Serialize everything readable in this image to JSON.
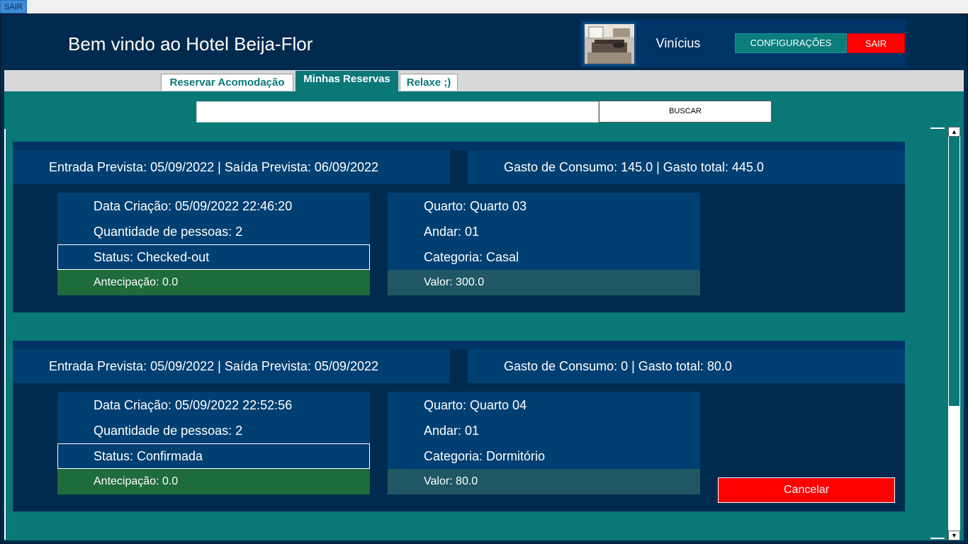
{
  "top_bar": {
    "exit_label": "SAIR"
  },
  "header": {
    "welcome": "Bem vindo ao Hotel Beija-Flor",
    "user_name": "Vinícius",
    "settings_label": "CONFIGURAÇÕES",
    "exit_label": "SAIR"
  },
  "tabs": [
    {
      "label": "Reservar Acomodação",
      "active": false
    },
    {
      "label": "Minhas Reservas",
      "active": true
    },
    {
      "label": "Relaxe ;)",
      "active": false
    }
  ],
  "search": {
    "value": "",
    "button_label": "BUSCAR"
  },
  "reservations": [
    {
      "dates": "Entrada Prevista: 05/09/2022 | Saída Prevista: 06/09/2022",
      "costs": "Gasto de Consumo: 145.0 | Gasto total: 445.0",
      "created": "Data Criação: 05/09/2022 22:46:20",
      "people": "Quantidade de pessoas: 2",
      "status": "Status: Checked-out",
      "anticipation": "Antecipação: 0.0",
      "room": "Quarto: Quarto 03",
      "floor": "Andar: 01",
      "category": "Categoria: Casal",
      "value": "Valor: 300.0"
    },
    {
      "dates": "Entrada Prevista: 05/09/2022 | Saída Prevista: 05/09/2022",
      "costs": "Gasto de Consumo: 0 | Gasto total: 80.0",
      "created": "Data Criação: 05/09/2022 22:52:56",
      "people": "Quantidade de pessoas: 2",
      "status": "Status: Confirmada",
      "anticipation": "Antecipação: 0.0",
      "room": "Quarto: Quarto 04",
      "floor": "Andar: 01",
      "category": "Categoria: Dormitório",
      "value": "Valor: 80.0",
      "cancel_label": "Cancelar"
    }
  ],
  "colors": {
    "background": "#002b4e",
    "panel": "#003f72",
    "teal": "#0b7878",
    "danger": "#ff0000",
    "anticipation": "#1e6b3c",
    "value": "#1f5864"
  }
}
